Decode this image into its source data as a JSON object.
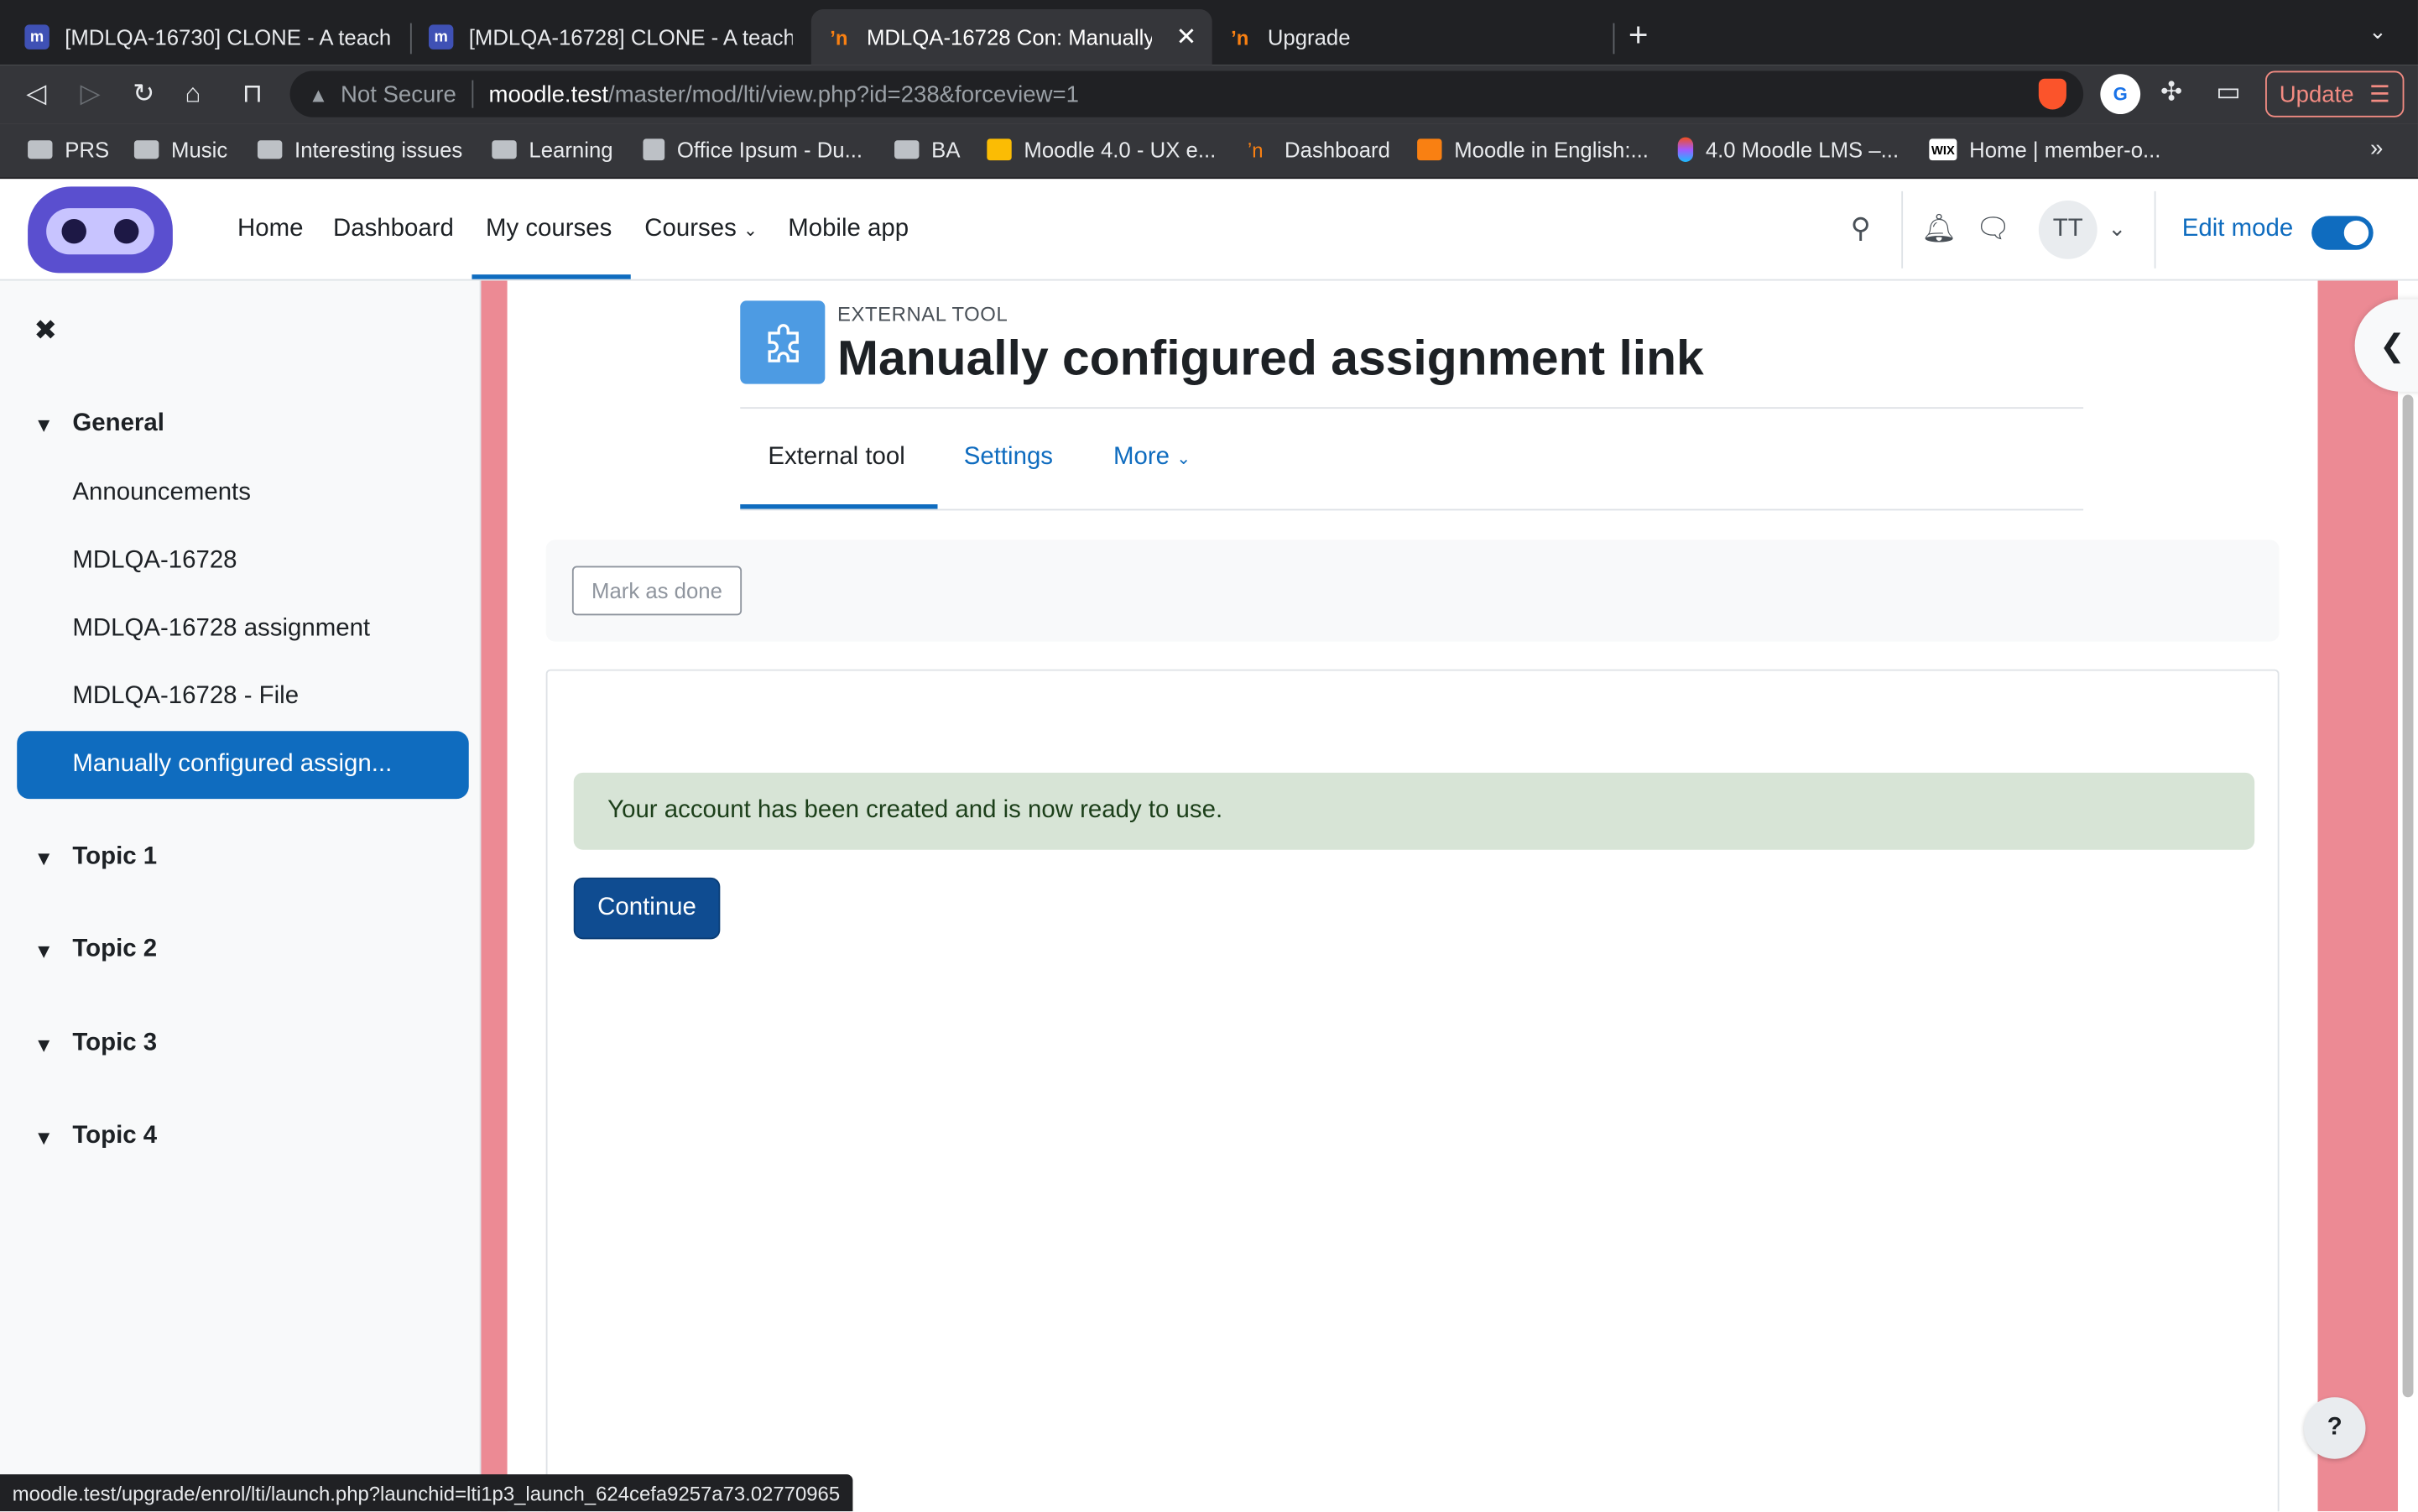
{
  "browser": {
    "tabs": [
      {
        "title": "[MDLQA-16730] CLONE - A teacher",
        "active": false
      },
      {
        "title": "[MDLQA-16728] CLONE - A teacher",
        "active": false
      },
      {
        "title": "MDLQA-16728 Con: Manually c",
        "active": true
      },
      {
        "title": "Upgrade",
        "active": false
      }
    ],
    "new_tab": "+",
    "tab_search": "⌄",
    "address": {
      "security_label": "Not Secure",
      "host": "moodle.test",
      "path": "/master/mod/lti/view.php?id=238&forceview=1"
    },
    "extension_g": "G",
    "update_label": "Update",
    "bookmarks": [
      {
        "label": "PRS",
        "icon": "folder-icon"
      },
      {
        "label": "Music",
        "icon": "folder-icon"
      },
      {
        "label": "Interesting issues",
        "icon": "folder-icon"
      },
      {
        "label": "Learning",
        "icon": "folder-icon"
      },
      {
        "label": "Office Ipsum - Du...",
        "icon": "page-icon"
      },
      {
        "label": "BA",
        "icon": "folder-icon"
      },
      {
        "label": "Moodle 4.0 - UX e...",
        "icon": "slides-icon"
      },
      {
        "label": "Dashboard",
        "icon": "moodle-icon"
      },
      {
        "label": "Moodle in English:...",
        "icon": "moodle-icon"
      },
      {
        "label": "4.0 Moodle LMS –...",
        "icon": "figma-icon"
      },
      {
        "label": "Home | member-o...",
        "icon": "wix-icon"
      }
    ],
    "bookmarks_more": "»",
    "status_url": "moodle.test/upgrade/enrol/lti/launch.php?launchid=lti1p3_launch_624cefa9257a73.02770965"
  },
  "navbar": {
    "links": [
      "Home",
      "Dashboard",
      "My courses",
      "Courses",
      "Mobile app"
    ],
    "active_link": "My courses",
    "avatar_initials": "TT",
    "edit_mode_label": "Edit mode",
    "edit_mode_on": true
  },
  "course_index": {
    "close": "✖",
    "sections": [
      {
        "title": "General",
        "items": [
          "Announcements",
          "MDLQA-16728",
          "MDLQA-16728 assignment",
          "MDLQA-16728 - File",
          "Manually configured assign..."
        ]
      },
      {
        "title": "Topic 1"
      },
      {
        "title": "Topic 2"
      },
      {
        "title": "Topic 3"
      },
      {
        "title": "Topic 4"
      }
    ],
    "active_item": "Manually configured assign..."
  },
  "page": {
    "activity_type": "EXTERNAL TOOL",
    "title": "Manually configured assignment link",
    "secondary_nav": [
      {
        "label": "External tool",
        "active": true
      },
      {
        "label": "Settings",
        "active": false
      },
      {
        "label": "More",
        "active": false
      }
    ],
    "mark_done_label": "Mark as done",
    "alert_message": "Your account has been created and is now ready to use.",
    "continue_label": "Continue",
    "help_label": "?"
  },
  "colors": {
    "brand_primary": "#0f6cbf",
    "edit_mode_band": "#ec8a94",
    "success_bg": "#d7e4d6",
    "continue_button": "#0f4c91"
  }
}
